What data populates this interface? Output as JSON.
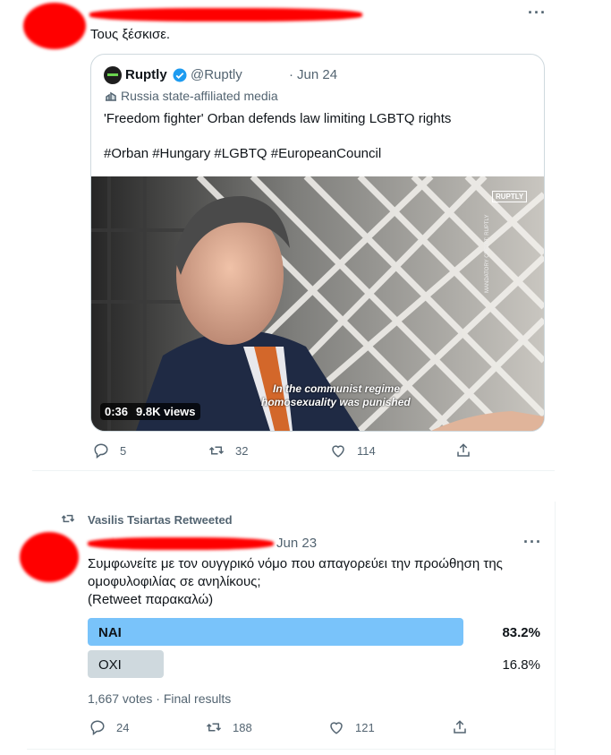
{
  "tweet1": {
    "text": "Τους ξέσκισε.",
    "more_icon": "more-horizontal-icon",
    "quote": {
      "name": "Ruptly",
      "handle": "@Ruptly",
      "sep": "·",
      "date": "Jun 24",
      "label": "Russia state-affiliated media",
      "text": "'Freedom fighter' Orban defends law limiting LGBTQ rights",
      "hashtags": "#Orban #Hungary #LGBTQ #EuropeanCouncil",
      "video": {
        "duration": "0:36",
        "views": "9.8K views",
        "watermark": "RUPTLY",
        "side_credit": "MANDATORY CREDIT: RUPTLY",
        "subtitle_line1": "In the communist regime",
        "subtitle_line2": "homosexuality was punished"
      }
    },
    "actions": {
      "replies": "5",
      "retweets": "32",
      "likes": "114"
    }
  },
  "tweet2": {
    "retweeted_by": "Vasilis Tsiartas Retweeted",
    "date": "Jun 23",
    "text_line1": "Συμφωνείτε με τον ουγγρικό νόμο που απαγορεύει την προώθηση της",
    "text_line2": "ομοφυλοφιλίας σε ανηλίκους;",
    "text_line3": "(Retweet παρακαλώ)",
    "poll": {
      "options": [
        {
          "label": "ΝΑΙ",
          "percent": "83.2%",
          "fraction": 0.832,
          "color": "#79c3fa"
        },
        {
          "label": "ΟΧΙ",
          "percent": "16.8%",
          "fraction": 0.168,
          "color": "#cfd9de"
        }
      ],
      "footer": "1,667 votes · Final results"
    },
    "actions": {
      "replies": "24",
      "retweets": "188",
      "likes": "121"
    }
  },
  "colors": {
    "accent": "#1d9bf0",
    "muted": "#536471",
    "redaction": "#ff0000"
  }
}
